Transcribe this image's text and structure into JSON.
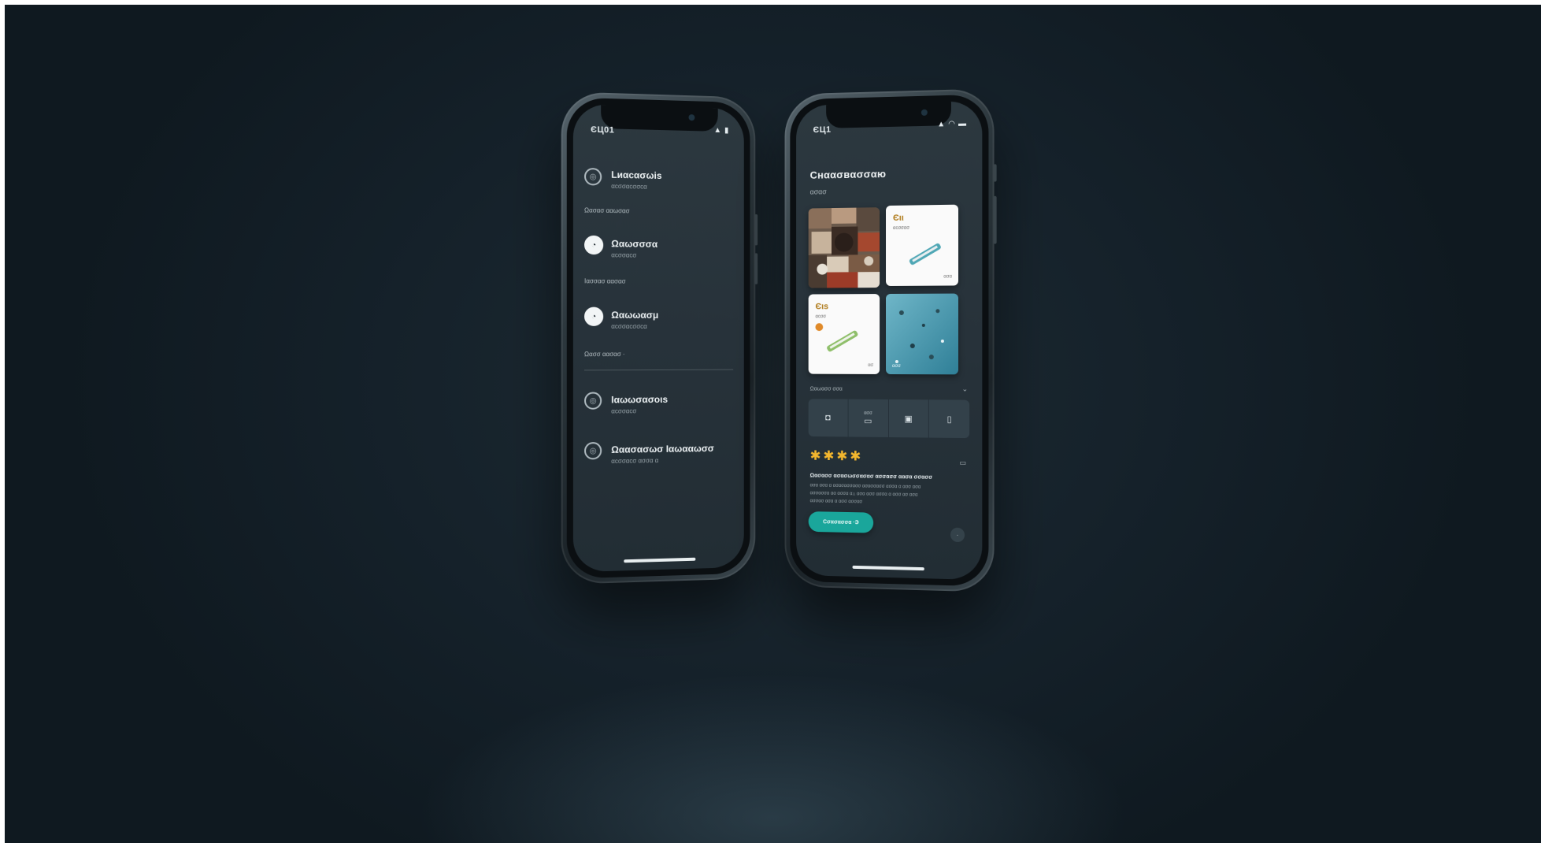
{
  "background": {
    "color": "#15212a",
    "accent": "#1aa69b",
    "star_color": "#f2b62e"
  },
  "phone_left": {
    "status": {
      "time": "ЄЦ01",
      "icons": [
        "signal-icon",
        "battery-icon"
      ]
    },
    "items": [
      {
        "title": "Lиαcασωis",
        "sub": "αcσσαcσσcα",
        "icon": "ring-icon"
      },
      {
        "title": "Ωαωσσσα",
        "sub": "αcσσαcσ",
        "icon": "face-icon"
      },
      {
        "title": "Ωαωωασμ",
        "sub": "αcσσαcσσcα",
        "icon": "face-icon"
      },
      {
        "title": "Ιαωωσασoιs",
        "sub": "αcσσαcσ",
        "icon": "ring-icon"
      },
      {
        "title": "Ωαασασωσ Ιαωααωσσ",
        "sub": "αcσσαcσ ασσα α",
        "icon": "ring-icon"
      }
    ],
    "notes": [
      "Ωασασ ααωσασ",
      "Ιασσασ αασασ",
      "Ωασσ αασασ ·"
    ]
  },
  "phone_right": {
    "status": {
      "time": "ЄЦ1",
      "icons": [
        "signal-icon",
        "wifi-icon",
        "battery-icon"
      ]
    },
    "title": "Cнαασвασσαю",
    "subtitle": "ασασ",
    "cards": [
      {
        "kind": "photo-mosaic"
      },
      {
        "kind": "ticket",
        "title": "Єιι",
        "sub": "αcσσασ",
        "tag": "ασα"
      },
      {
        "kind": "ticket",
        "title": "Єιs",
        "sub": "αcσσ",
        "tag": "ασ"
      },
      {
        "kind": "photo-sea",
        "foot": "ασσ"
      }
    ],
    "segment_label": "Ωαωασσ σσα",
    "segments": [
      {
        "icon": "glasses-icon",
        "caption": ""
      },
      {
        "icon": "card-icon",
        "caption": "ασσ"
      },
      {
        "icon": "wallet-icon",
        "caption": ""
      },
      {
        "icon": "phone-icon",
        "caption": ""
      }
    ],
    "rating": 4,
    "review": {
      "headline": "Ωασασσ ασασωσσασασ ασσασσ αασα σσασσ",
      "lines": [
        "ασα ασα α ασασασσασσ ασασσασσ ασσα α ασσ ασα",
        "ασσασσα αα ασσα αΞ ασα ασσ ασσα α ασσ ασ ασα",
        "ασσασ ασα α ασσ ασσασ"
      ]
    },
    "cta_label": "Cσασασσα ·Э",
    "more_label": "·"
  }
}
